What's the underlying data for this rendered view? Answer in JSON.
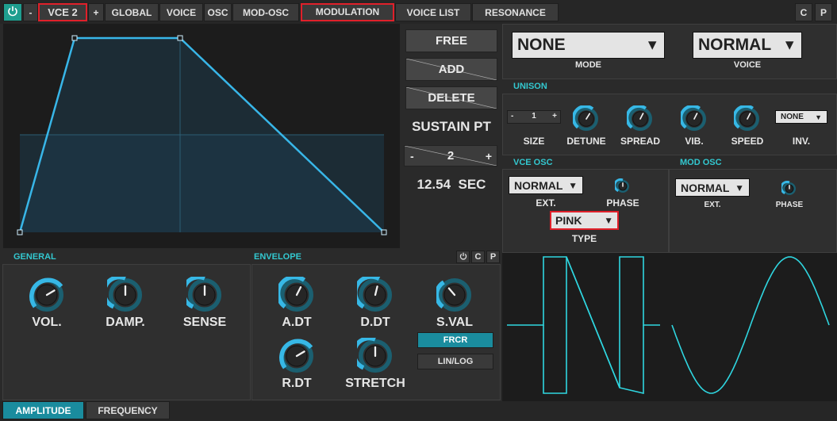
{
  "topbar": {
    "power_icon": "power-icon",
    "minus_label": "-",
    "voice_label": "VCE 2",
    "plus_label": "+",
    "tabs": [
      "GLOBAL",
      "VOICE",
      "OSC",
      "MOD-OSC",
      "MODULATION",
      "VOICE LIST",
      "RESONANCE"
    ],
    "selected_tab": "MODULATION",
    "c_label": "C",
    "p_label": "P"
  },
  "envelope_editor": {
    "free_label": "FREE",
    "add_label": "ADD",
    "delete_label": "DELETE",
    "sustain_label": "SUSTAIN PT",
    "sustain_minus": "-",
    "sustain_value": "2",
    "sustain_plus": "+",
    "time_readout": "12.54  SEC"
  },
  "mode_panel": {
    "mode_value": "NONE",
    "mode_label": "MODE",
    "voice_value": "NORMAL",
    "voice_label": "VOICE"
  },
  "unison": {
    "heading": "UNISON",
    "size_minus": "-",
    "size_value": "1",
    "size_plus": "+",
    "size_label": "SIZE",
    "detune_label": "DETUNE",
    "spread_label": "SPREAD",
    "vib_label": "VIB.",
    "speed_label": "SPEED",
    "inv_value": "NONE",
    "inv_label": "INV."
  },
  "vce_osc": {
    "heading": "VCE OSC",
    "ext_value": "NORMAL",
    "ext_label": "EXT.",
    "phase_label": "PHASE",
    "type_value": "PINK",
    "type_label": "TYPE"
  },
  "mod_osc": {
    "heading": "MOD OSC",
    "ext_value": "NORMAL",
    "ext_label": "EXT.",
    "phase_label": "PHASE"
  },
  "general": {
    "heading": "GENERAL",
    "vol_label": "VOL.",
    "damp_label": "DAMP.",
    "sense_label": "SENSE"
  },
  "envelope": {
    "heading": "ENVELOPE",
    "power_icon": "power-icon",
    "c_label": "C",
    "p_label": "P",
    "adt_label": "A.DT",
    "ddt_label": "D.DT",
    "sval_label": "S.VAL",
    "rdt_label": "R.DT",
    "stretch_label": "STRETCH",
    "frcr_label": "FRCR",
    "linlog_label": "LIN/LOG"
  },
  "bottom_tabs": {
    "amplitude": "AMPLITUDE",
    "frequency": "FREQUENCY",
    "selected": "AMPLITUDE"
  },
  "colors": {
    "accent": "#2aa7b5",
    "highlight_border": "#e0202a",
    "wave": "#2fd6e0"
  }
}
